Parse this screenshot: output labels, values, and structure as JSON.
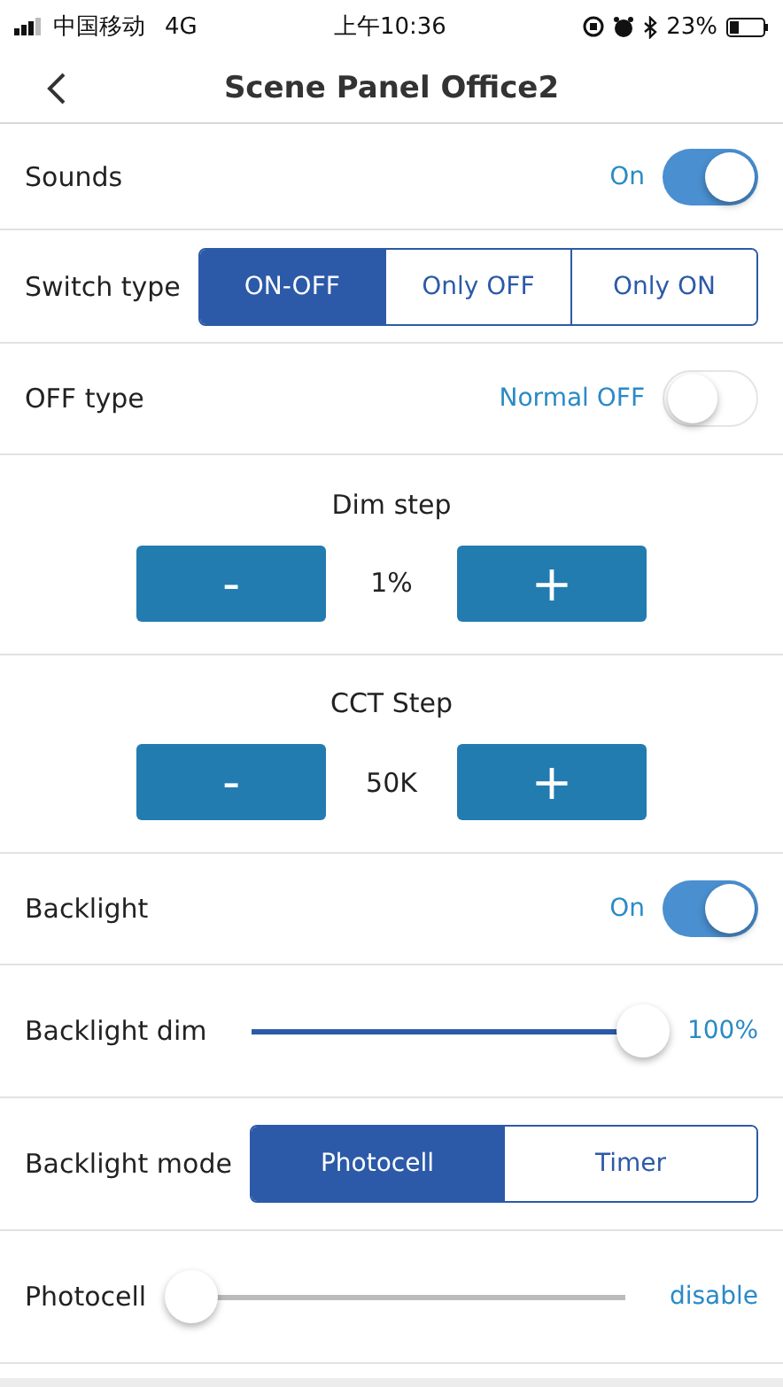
{
  "status_bar": {
    "carrier": "中国移动",
    "network": "4G",
    "time": "上午10:36",
    "battery": "23%"
  },
  "nav": {
    "title": "Scene Panel Office2"
  },
  "rows": [
    {
      "kind": "toggle",
      "label": "Sounds",
      "value": "On",
      "on": true
    },
    {
      "kind": "segmented",
      "label": "Switch type",
      "options": [
        {
          "label": "ON-OFF",
          "selected": true
        },
        {
          "label": "Only OFF",
          "selected": false
        },
        {
          "label": "Only ON",
          "selected": false
        }
      ]
    },
    {
      "kind": "toggle",
      "label": "OFF type",
      "value": "Normal OFF",
      "on": false
    },
    {
      "kind": "stepper",
      "label": "Dim step",
      "minus": "-",
      "value": "1%",
      "plus": "+"
    },
    {
      "kind": "stepper",
      "label": "CCT Step",
      "minus": "-",
      "value": "50K",
      "plus": "+"
    },
    {
      "kind": "toggle",
      "label": "Backlight",
      "value": "On",
      "on": true
    },
    {
      "kind": "slider",
      "label": "Backlight dim",
      "level": 1,
      "reading": "100%"
    },
    {
      "kind": "segmented",
      "label": "Backlight mode",
      "options": [
        {
          "label": "Photocell",
          "selected": true
        },
        {
          "label": "Timer",
          "selected": false
        }
      ]
    },
    {
      "kind": "slider",
      "label": "Photocell",
      "level": 0,
      "reading": "disable"
    }
  ]
}
